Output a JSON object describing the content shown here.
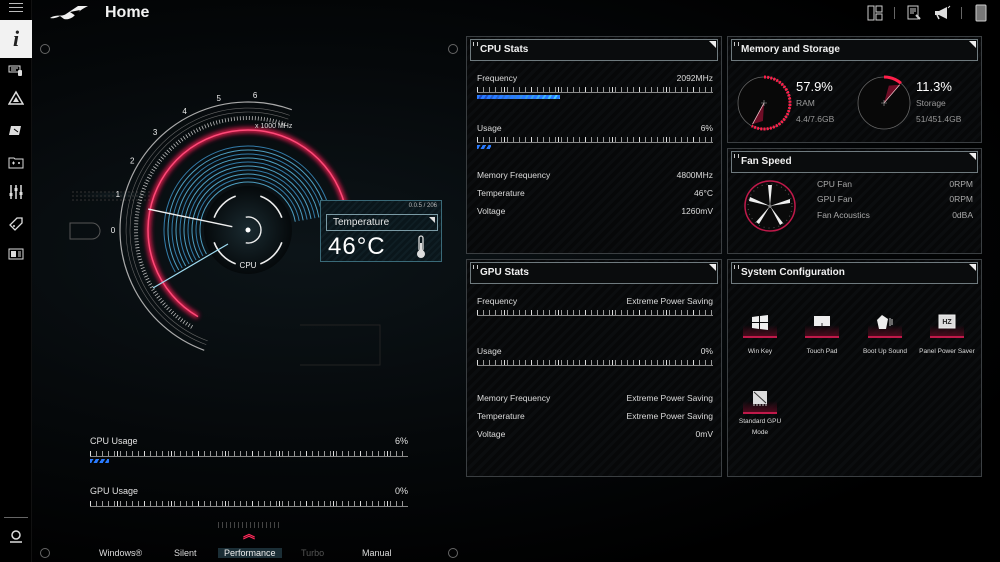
{
  "header": {
    "title": "Home"
  },
  "sidebar": {
    "items": [
      {
        "name": "home",
        "icon": "info-icon",
        "glyph": "i",
        "active": true
      },
      {
        "name": "device",
        "icon": "keyboard-device-icon"
      },
      {
        "name": "armoury-crate",
        "icon": "triangle-logo-icon"
      },
      {
        "name": "scenario-profiles",
        "icon": "profile-icon"
      },
      {
        "name": "game-library",
        "icon": "folder-game-icon"
      },
      {
        "name": "settings-tuning",
        "icon": "sliders-icon"
      },
      {
        "name": "deals",
        "icon": "tag-icon"
      },
      {
        "name": "news",
        "icon": "news-card-icon"
      }
    ],
    "bottom_item": {
      "name": "user-center",
      "icon": "user-icon"
    }
  },
  "top_icons": [
    "layout-icon",
    "notes-icon",
    "megaphone-icon",
    "phone-icon"
  ],
  "gauge": {
    "scale_labels": [
      "0",
      "1",
      "2",
      "3",
      "4",
      "5",
      "6"
    ],
    "unit": "x 1000 MHz",
    "center_label": "CPU",
    "value_ghz": 2.092
  },
  "temperature_card": {
    "id": "0.0.5 / 206",
    "label": "Temperature",
    "value": "46°C"
  },
  "usage": {
    "cpu": {
      "label": "CPU Usage",
      "value": "6%",
      "fraction": 0.06
    },
    "gpu": {
      "label": "GPU Usage",
      "value": "0%",
      "fraction": 0.0
    }
  },
  "modes": {
    "items": [
      "Windows®",
      "Silent",
      "Performance",
      "Turbo",
      "Manual"
    ],
    "active": "Performance",
    "disabled": [
      "Turbo"
    ]
  },
  "cpu_stats": {
    "title": "CPU Stats",
    "frequency": {
      "label": "Frequency",
      "value": "2092MHz",
      "fraction": 0.35
    },
    "usage": {
      "label": "Usage",
      "value": "6%",
      "fraction": 0.06
    },
    "memory_frequency": {
      "label": "Memory Frequency",
      "value": "4800MHz"
    },
    "temperature": {
      "label": "Temperature",
      "value": "46°C"
    },
    "voltage": {
      "label": "Voltage",
      "value": "1260mV"
    }
  },
  "gpu_stats": {
    "title": "GPU Stats",
    "frequency": {
      "label": "Frequency",
      "value": "Extreme Power Saving",
      "fraction": 0
    },
    "usage": {
      "label": "Usage",
      "value": "0%",
      "fraction": 0
    },
    "memory_frequency": {
      "label": "Memory Frequency",
      "value": "Extreme Power Saving"
    },
    "temperature": {
      "label": "Temperature",
      "value": "Extreme Power Saving"
    },
    "voltage": {
      "label": "Voltage",
      "value": "0mV"
    }
  },
  "memory_storage": {
    "title": "Memory and Storage",
    "ram": {
      "percent": "57.9%",
      "label": "RAM",
      "detail": "4.4/7.6GB",
      "fraction": 0.579
    },
    "storage": {
      "percent": "11.3%",
      "label": "Storage",
      "detail": "51/451.4GB",
      "fraction": 0.113
    }
  },
  "fan_speed": {
    "title": "Fan Speed",
    "rows": [
      {
        "label": "CPU Fan",
        "value": "0RPM"
      },
      {
        "label": "GPU Fan",
        "value": "0RPM"
      },
      {
        "label": "Fan Acoustics",
        "value": "0dBA"
      }
    ]
  },
  "system_config": {
    "title": "System Configuration",
    "items": [
      {
        "label": "Win Key",
        "icon": "windows-key-icon"
      },
      {
        "label": "Touch Pad",
        "icon": "touchpad-icon"
      },
      {
        "label": "Boot Up Sound",
        "icon": "boot-sound-icon"
      },
      {
        "label": "Panel Power Saver",
        "icon": "panel-hz-icon"
      },
      {
        "label": "Standard GPU Mode",
        "icon": "gpu-mode-icon"
      }
    ]
  },
  "colors": {
    "accent_red": "#ff1f55",
    "accent_blue": "#2a7bff",
    "cyan": "#43c6e8"
  }
}
